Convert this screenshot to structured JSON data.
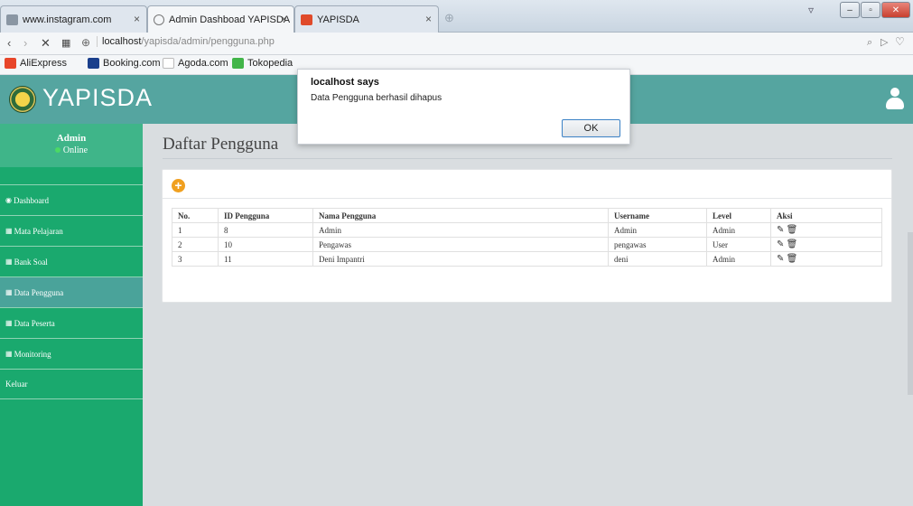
{
  "browser": {
    "tabs": [
      {
        "title": "www.instagram.com",
        "close": "×"
      },
      {
        "title": "Admin Dashboad YAPISDA",
        "close": "×"
      },
      {
        "title": "YAPISDA",
        "close": "×"
      }
    ],
    "url_host": "localhost",
    "url_path": "/yapisda/admin/pengguna.php",
    "bookmarks": [
      "AliExpress",
      "Booking.com",
      "Agoda.com",
      "Tokopedia"
    ]
  },
  "app": {
    "brand": "YAPISDA",
    "user": {
      "name": "Admin",
      "status": "Online"
    },
    "menu": [
      {
        "label": "Dashboard",
        "icon": "dashboard-icon",
        "active": false
      },
      {
        "label": "Mata Pelajaran",
        "icon": "table-icon",
        "active": false
      },
      {
        "label": "Bank Soal",
        "icon": "table-icon",
        "active": false
      },
      {
        "label": "Data Pengguna",
        "icon": "table-icon",
        "active": true
      },
      {
        "label": "Data Peserta",
        "icon": "table-icon",
        "active": false
      },
      {
        "label": "Monitoring",
        "icon": "table-icon",
        "active": false
      },
      {
        "label": "Keluar",
        "icon": "",
        "active": false
      }
    ],
    "page_title": "Daftar Pengguna",
    "table": {
      "headers": [
        "No.",
        "ID Pengguna",
        "Nama Pengguna",
        "Username",
        "Level",
        "Aksi"
      ],
      "rows": [
        [
          "1",
          "8",
          "Admin",
          "Admin",
          "Admin"
        ],
        [
          "2",
          "10",
          "Pengawas",
          "pengawas",
          "User"
        ],
        [
          "3",
          "11",
          "Deni Impantri",
          "deni",
          "Admin"
        ]
      ]
    },
    "colors": {
      "header": "#55a5a0",
      "sidebar": "#1aa96e",
      "active_item": "#4aa39a",
      "add_button": "#f0a020",
      "online_dot": "#4cd964"
    }
  },
  "dialog": {
    "title": "localhost says",
    "message": "Data Pengguna berhasil dihapus",
    "ok_label": "OK"
  }
}
